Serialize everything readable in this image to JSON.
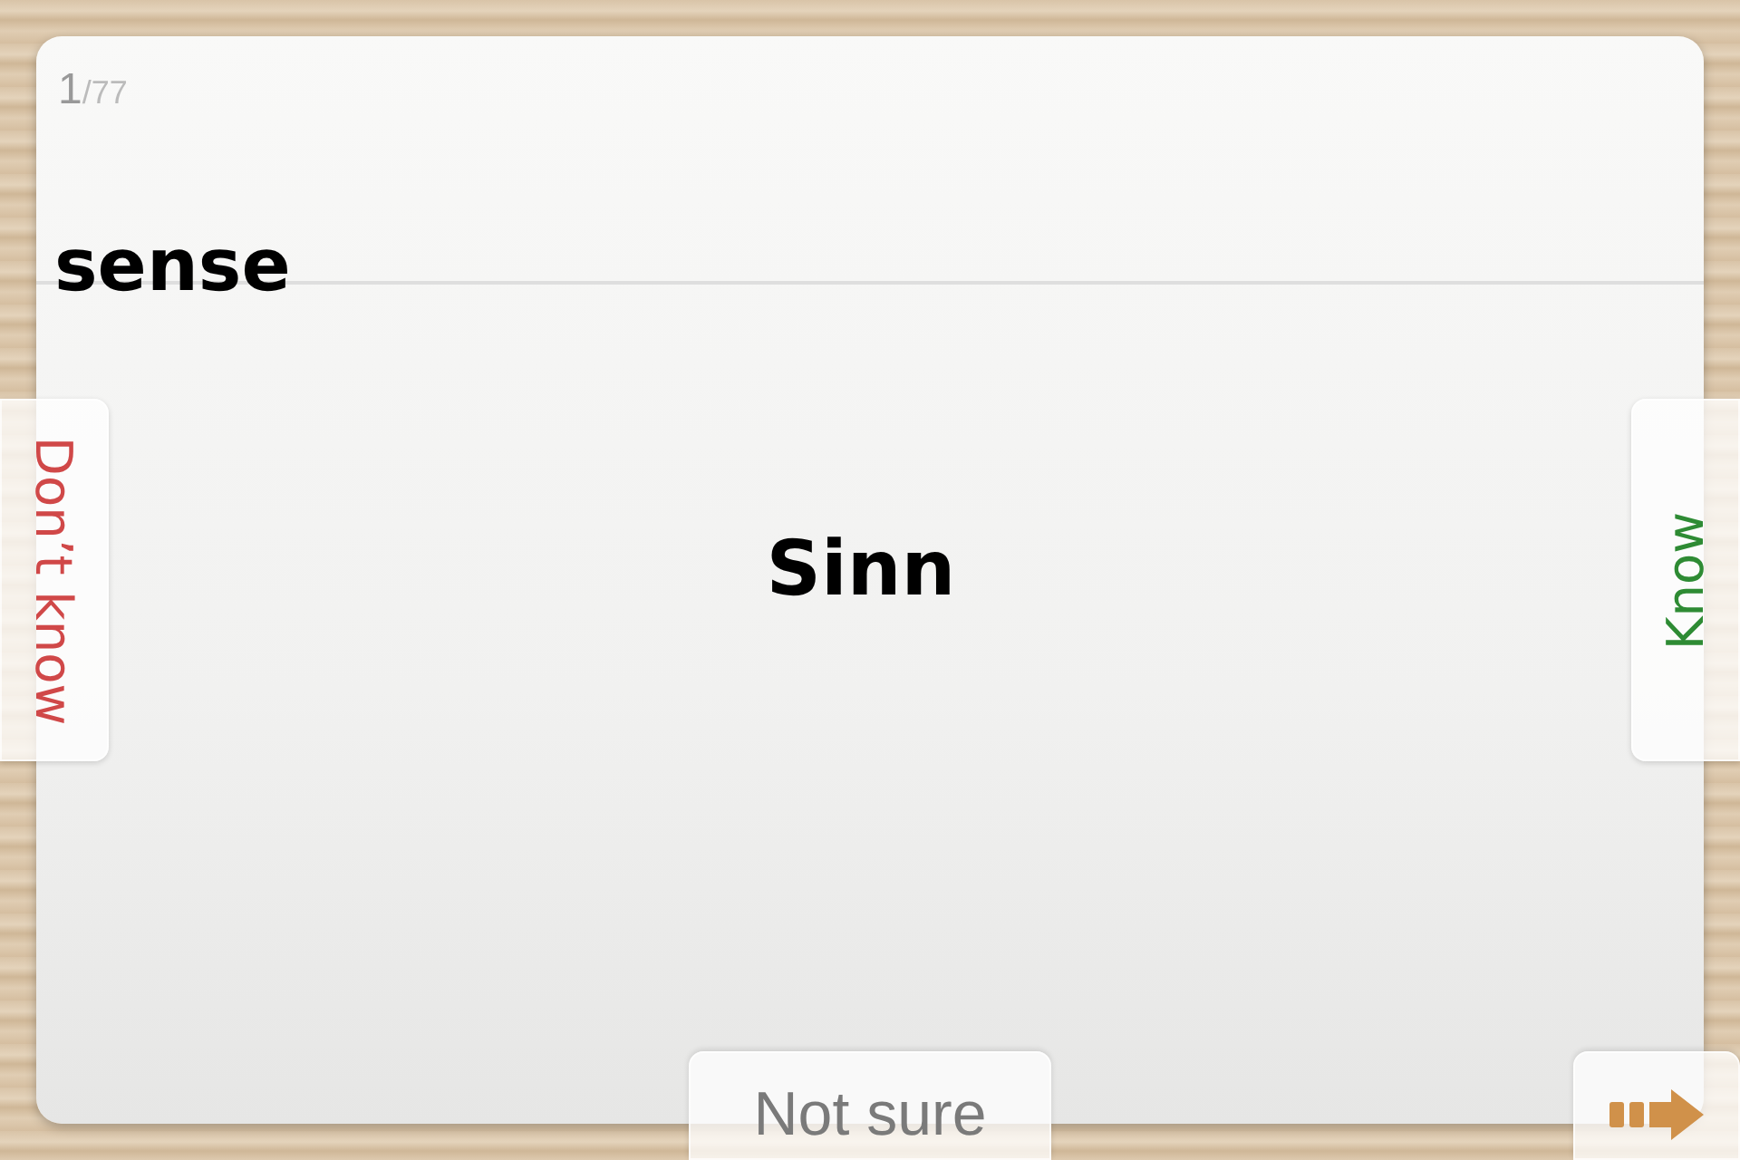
{
  "counter": {
    "current": "1",
    "total": "/77"
  },
  "term": "sense",
  "translation": "Sinn",
  "buttons": [
    {
      "kind": "dont_know",
      "label": "Don’t know"
    },
    {
      "kind": "know",
      "label": "Know"
    },
    {
      "kind": "not_sure",
      "label": "Not sure"
    },
    {
      "kind": "next"
    }
  ]
}
